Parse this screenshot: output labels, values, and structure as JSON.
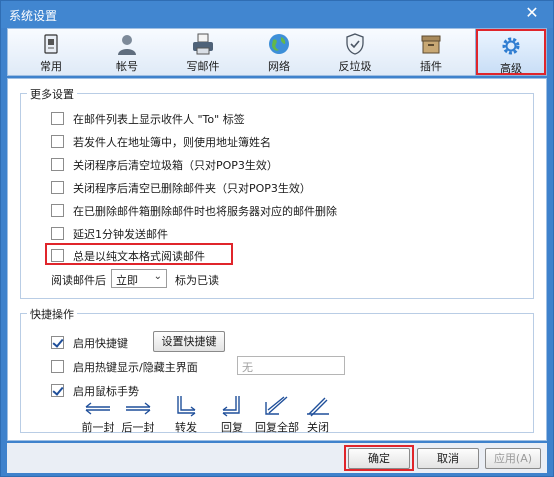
{
  "window": {
    "title": "系统设置"
  },
  "toolbar": {
    "tabs": [
      {
        "label": "常用",
        "icon": "phone-icon"
      },
      {
        "label": "帐号",
        "icon": "user-icon"
      },
      {
        "label": "写邮件",
        "icon": "printer-icon"
      },
      {
        "label": "网络",
        "icon": "globe-icon"
      },
      {
        "label": "反垃圾",
        "icon": "shield-icon"
      },
      {
        "label": "插件",
        "icon": "box-icon"
      },
      {
        "label": "高级",
        "icon": "gear-icon",
        "selected": true
      }
    ]
  },
  "more_settings": {
    "title": "更多设置",
    "options": [
      {
        "label": "在邮件列表上显示收件人 \"To\" 标签",
        "checked": false
      },
      {
        "label": "若发件人在地址簿中，则使用地址簿姓名",
        "checked": false
      },
      {
        "label": "关闭程序后清空垃圾箱（只对POP3生效）",
        "checked": false
      },
      {
        "label": "关闭程序后清空已删除邮件夹（只对POP3生效）",
        "checked": false
      },
      {
        "label": "在已删除邮件箱删除邮件时也将服务器对应的邮件删除",
        "checked": false
      },
      {
        "label": "延迟1分钟发送邮件",
        "checked": false
      },
      {
        "label": "总是以纯文本格式阅读邮件",
        "checked": false
      }
    ],
    "read_prefix": "阅读邮件后",
    "read_select_value": "立即",
    "read_suffix": "标为已读"
  },
  "shortcuts": {
    "title": "快捷操作",
    "enable_hotkeys": {
      "label": "启用快捷键",
      "checked": true
    },
    "set_hotkeys_button": "设置快捷键",
    "hotkey_toggle": {
      "label": "启用热键显示/隐藏主界面",
      "checked": false
    },
    "hotkey_value": "无",
    "mouse_gesture": {
      "label": "启用鼠标手势",
      "checked": true
    },
    "gestures": [
      "前一封",
      "后一封",
      "转发",
      "回复",
      "回复全部",
      "关闭"
    ]
  },
  "footer": {
    "ok": "确定",
    "cancel": "取消",
    "apply": "应用(A)"
  },
  "colors": {
    "title_bar": "#4186d0",
    "highlight": "#e0252b"
  }
}
